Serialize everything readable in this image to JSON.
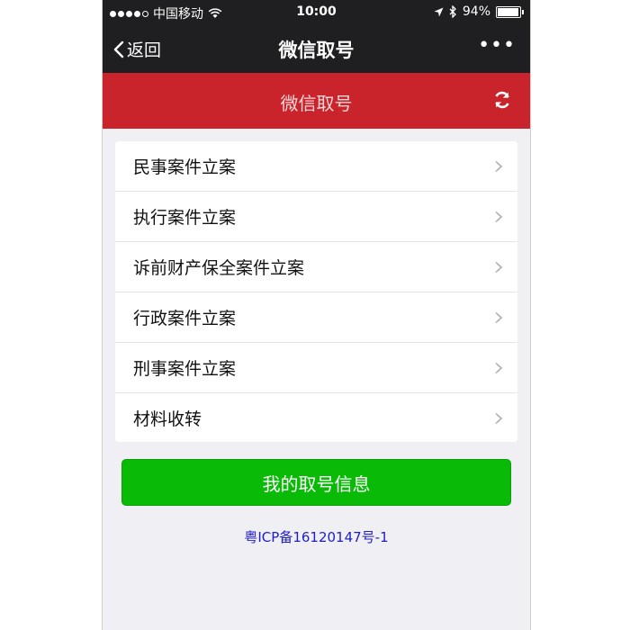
{
  "status_bar": {
    "carrier": "中国移动",
    "time": "10:00",
    "battery_text": "94%",
    "battery_level": 0.94
  },
  "nav": {
    "back_label": "返回",
    "title": "微信取号",
    "more_label": "•••"
  },
  "header": {
    "title": "微信取号",
    "accent": "#c9232b"
  },
  "menu": {
    "items": [
      {
        "label": "民事案件立案"
      },
      {
        "label": "执行案件立案"
      },
      {
        "label": "诉前财产保全案件立案"
      },
      {
        "label": "行政案件立案"
      },
      {
        "label": "刑事案件立案"
      },
      {
        "label": "材料收转"
      }
    ]
  },
  "primary_button": {
    "label": "我的取号信息",
    "color": "#09bb07"
  },
  "footer": {
    "icp": "粤ICP备16120147号-1"
  }
}
